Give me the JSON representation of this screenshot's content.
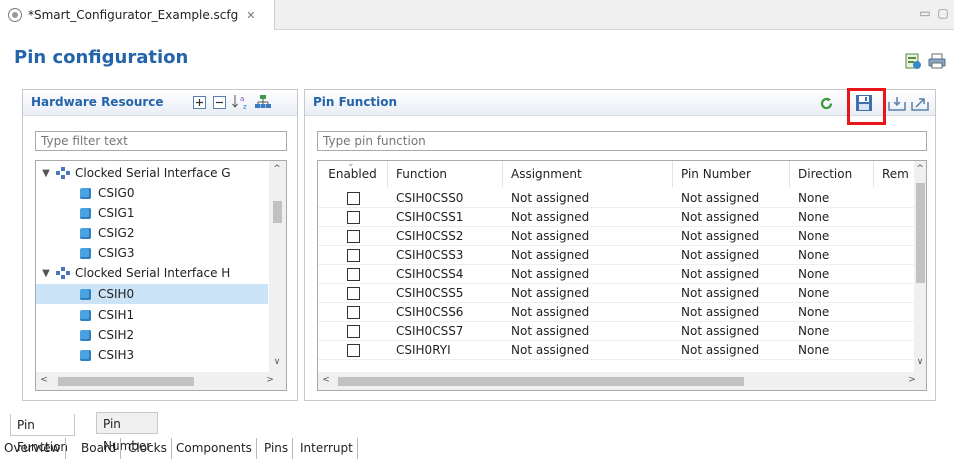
{
  "editor": {
    "tab_title": "*Smart_Configurator_Example.scfg",
    "tab_close": "✕",
    "minimize": "▭",
    "maximize": "▢"
  },
  "page": {
    "title": "Pin configuration"
  },
  "hardware_panel": {
    "title": "Hardware Resource",
    "filter_placeholder": "Type filter text",
    "tree": [
      {
        "label": "Clocked Serial Interface G",
        "type": "group",
        "expanded": true
      },
      {
        "label": "CSIG0",
        "type": "leaf"
      },
      {
        "label": "CSIG1",
        "type": "leaf"
      },
      {
        "label": "CSIG2",
        "type": "leaf"
      },
      {
        "label": "CSIG3",
        "type": "leaf"
      },
      {
        "label": "Clocked Serial Interface H",
        "type": "group",
        "expanded": true
      },
      {
        "label": "CSIH0",
        "type": "leaf",
        "selected": true
      },
      {
        "label": "CSIH1",
        "type": "leaf"
      },
      {
        "label": "CSIH2",
        "type": "leaf"
      },
      {
        "label": "CSIH3",
        "type": "leaf"
      }
    ]
  },
  "pin_panel": {
    "title": "Pin Function",
    "filter_placeholder": "Type pin function",
    "columns": [
      "Enabled",
      "Function",
      "Assignment",
      "Pin Number",
      "Direction",
      "Rem"
    ],
    "rows": [
      {
        "enabled": false,
        "function": "CSIH0CSS0",
        "assignment": "Not assigned",
        "pin_number": "Not assigned",
        "direction": "None"
      },
      {
        "enabled": false,
        "function": "CSIH0CSS1",
        "assignment": "Not assigned",
        "pin_number": "Not assigned",
        "direction": "None"
      },
      {
        "enabled": false,
        "function": "CSIH0CSS2",
        "assignment": "Not assigned",
        "pin_number": "Not assigned",
        "direction": "None"
      },
      {
        "enabled": false,
        "function": "CSIH0CSS3",
        "assignment": "Not assigned",
        "pin_number": "Not assigned",
        "direction": "None"
      },
      {
        "enabled": false,
        "function": "CSIH0CSS4",
        "assignment": "Not assigned",
        "pin_number": "Not assigned",
        "direction": "None"
      },
      {
        "enabled": false,
        "function": "CSIH0CSS5",
        "assignment": "Not assigned",
        "pin_number": "Not assigned",
        "direction": "None"
      },
      {
        "enabled": false,
        "function": "CSIH0CSS6",
        "assignment": "Not assigned",
        "pin_number": "Not assigned",
        "direction": "None"
      },
      {
        "enabled": false,
        "function": "CSIH0CSS7",
        "assignment": "Not assigned",
        "pin_number": "Not assigned",
        "direction": "None"
      },
      {
        "enabled": false,
        "function": "CSIH0RYI",
        "assignment": "Not assigned",
        "pin_number": "Not assigned",
        "direction": "None"
      }
    ]
  },
  "view_tabs": [
    "Pin Function",
    "Pin Number"
  ],
  "editor_pages": [
    "Overview",
    "Board",
    "Clocks",
    "Components",
    "Pins",
    "Interrupt"
  ],
  "colors": {
    "title_blue": "#2464a8",
    "highlight_red": "#e8161a",
    "selection": "#cce4f7"
  }
}
